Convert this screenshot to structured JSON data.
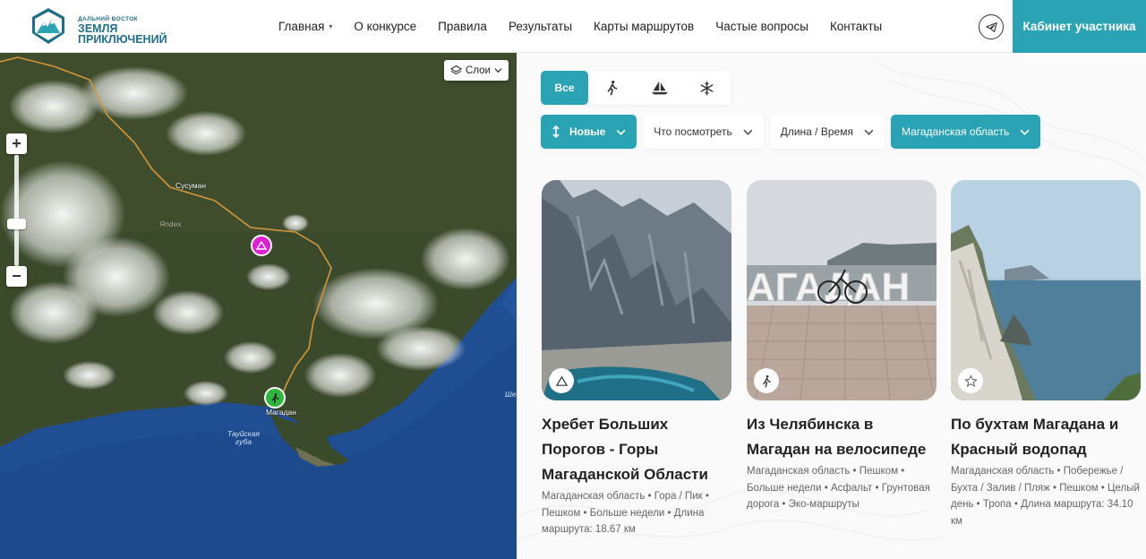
{
  "header": {
    "logo_sub": "ДАЛЬНИЙ ВОСТОК",
    "logo_title_1": "ЗЕМЛЯ",
    "logo_title_2": "ПРИКЛЮЧЕНИЙ",
    "nav": [
      "Главная",
      "О конкурсе",
      "Правила",
      "Результаты",
      "Карты маршрутов",
      "Частые вопросы",
      "Контакты"
    ],
    "cabinet_label": "Кабинет участника",
    "telegram_icon": "telegram-icon"
  },
  "map": {
    "layers_label": "Слои",
    "labels": {
      "susuman": "Сусуман",
      "yandex": "Яndex",
      "magadan": "Магадан",
      "bay_1": "Тауйская",
      "bay_2": "губа",
      "edge": "Ше"
    },
    "marker_colors": {
      "mountain": "#e01fd2",
      "hiking": "#2db83b"
    }
  },
  "filters": {
    "types": [
      "Все"
    ],
    "type_icons": [
      "hiking-icon",
      "sailboat-icon",
      "snowflake-icon"
    ],
    "sort_label": "Новые",
    "what_label": "Что посмотреть",
    "length_label": "Длина / Время",
    "region_label": "Магаданская область"
  },
  "cards": [
    {
      "title": "Хребет Больших Порогов - Горы Магаданской Области",
      "meta": "Магаданская область • Гора / Пик • Пешком • Больше недели • Длина маршрута: 18.67 км",
      "icon": "mountain-icon"
    },
    {
      "title": "Из Челябинска в Магадан на велосипеде",
      "meta": "Магаданская область • Пешком • Больше недели • Асфальт • Грунтовая дорога • Эко-маршруты",
      "icon": "hiking-icon",
      "sign_text": "АГАДАН"
    },
    {
      "title": "По бухтам Магадана и Красный водопад",
      "meta": "Магаданская область • Побережье / Бухта / Залив / Пляж • Пешком • Целый день • Тропа • Длина маршрута: 34.10 км",
      "icon": "star-icon"
    }
  ],
  "colors": {
    "accent": "#2aa4b5",
    "logo": "#1f6f8b"
  }
}
